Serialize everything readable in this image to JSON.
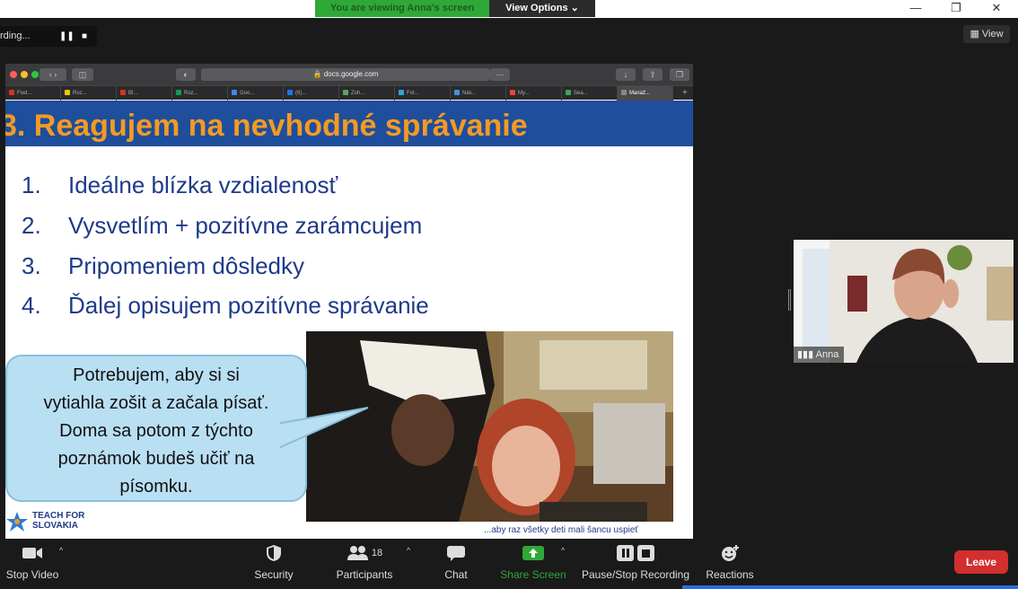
{
  "zoom": {
    "banner": "You are viewing Anna's screen",
    "view_options": "View Options",
    "recording_label": "rding...",
    "view_label": "View",
    "participant_name": "Anna",
    "participants_count": "18"
  },
  "browser": {
    "url": "docs.google.com",
    "tabs": [
      {
        "label": "Fwd...",
        "color": "#d93025"
      },
      {
        "label": "Roz...",
        "color": "#f4c20d"
      },
      {
        "label": "Bl...",
        "color": "#d93025"
      },
      {
        "label": "Roz...",
        "color": "#0f9d58"
      },
      {
        "label": "Goo...",
        "color": "#4285f4"
      },
      {
        "label": "(6)...",
        "color": "#1877f2"
      },
      {
        "label": "Zoh...",
        "color": "#5fa35f"
      },
      {
        "label": "Fot...",
        "color": "#2ca5e0"
      },
      {
        "label": "Náv...",
        "color": "#4a90e2"
      },
      {
        "label": "My...",
        "color": "#ea4335"
      },
      {
        "label": "Sea...",
        "color": "#34a853"
      },
      {
        "label": "Manaž...",
        "color": "#888888"
      }
    ]
  },
  "slide": {
    "title": "3. Reagujem na nevhodné správanie",
    "items": [
      {
        "num": "1.",
        "text": "Ideálne blízka vzdialenosť"
      },
      {
        "num": "2.",
        "text": "Vysvetlím + pozitívne zarámcujem"
      },
      {
        "num": "3.",
        "text": "Pripomeniem dôsledky"
      },
      {
        "num": "4.",
        "text": "Ďalej opisujem pozitívne správanie"
      }
    ],
    "bubble_lines": [
      "Potrebujem, aby si si",
      "vytiahla zošit a začala písať.",
      "Doma sa potom z týchto",
      "poznámok budeš učiť na",
      "písomku."
    ],
    "logo_line1": "TEACH FOR",
    "logo_line2": "SLOVAKIA",
    "caption": "...aby raz všetky deti mali šancu uspieť"
  },
  "toolbar": {
    "stop_video": "Stop Video",
    "security": "Security",
    "participants": "Participants",
    "chat": "Chat",
    "share_screen": "Share Screen",
    "pause_recording": "Pause/Stop Recording",
    "reactions": "Reactions",
    "leave": "Leave"
  },
  "colors": {
    "banner_green": "#2fa838",
    "slide_header_blue": "#1f4e9c",
    "title_orange": "#f39a24",
    "text_blue": "#1f3a8a",
    "leave_red": "#d32f2f",
    "share_green": "#2fa838"
  }
}
